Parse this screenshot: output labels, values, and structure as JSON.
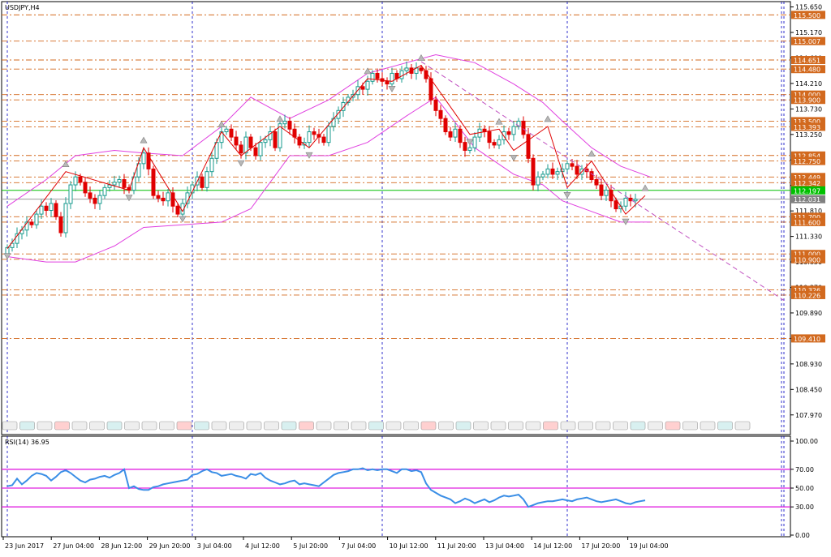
{
  "window": {
    "title": "USDJPY,H4",
    "rsi_label": "RSI(14) 36.95"
  },
  "colors": {
    "bull": "#1a9b8f",
    "bear": "#e00000",
    "bands": "#e040e0",
    "levels": "#d2691e",
    "level_label_bg": "#d2691e",
    "bid_line": "#9a9a9a",
    "green_line": "#00c000",
    "zigzag": "#e00000",
    "trend": "#c050c0",
    "grid": "#0000c0",
    "rsi_line": "#3a8ee6",
    "rsi_levels": "#e020e0"
  },
  "chart_data": [
    {
      "type": "candlestick",
      "title": "USDJPY,H4",
      "ylim": [
        107.6,
        115.75
      ],
      "price_ticks": [
        "115.650",
        "115.170",
        "114.690",
        "114.210",
        "113.730",
        "113.250",
        "112.770",
        "112.290",
        "111.810",
        "111.330",
        "110.850",
        "110.370",
        "109.890",
        "109.410",
        "108.930",
        "108.450",
        "107.970"
      ],
      "date_labels": [
        "23 Jun 2017",
        "27 Jun 04:00",
        "28 Jun 12:00",
        "29 Jun 20:00",
        "3 Jul 04:00",
        "4 Jul 12:00",
        "5 Jul 20:00",
        "7 Jul 04:00",
        "10 Jul 12:00",
        "11 Jul 20:00",
        "13 Jul 04:00",
        "14 Jul 12:00",
        "17 Jul 20:00",
        "19 Jul 04:00"
      ],
      "horizontal_levels": [
        {
          "price": 115.5,
          "label": "115.500"
        },
        {
          "price": 115.007,
          "label": "115.007"
        },
        {
          "price": 114.651,
          "label": "114.651"
        },
        {
          "price": 114.48,
          "label": "114.480"
        },
        {
          "price": 114.0,
          "label": "114.000"
        },
        {
          "price": 113.9,
          "label": "113.900"
        },
        {
          "price": 113.5,
          "label": "113.500"
        },
        {
          "price": 113.393,
          "label": "113.393"
        },
        {
          "price": 112.854,
          "label": "112.854"
        },
        {
          "price": 112.75,
          "label": "112.750"
        },
        {
          "price": 112.449,
          "label": "112.449"
        },
        {
          "price": 112.342,
          "label": "112.342"
        },
        {
          "price": 111.7,
          "label": "111.700"
        },
        {
          "price": 111.6,
          "label": "111.600"
        },
        {
          "price": 111.0,
          "label": "111.000"
        },
        {
          "price": 110.9,
          "label": "110.900"
        },
        {
          "price": 110.326,
          "label": "110.326"
        },
        {
          "price": 110.226,
          "label": "110.226"
        },
        {
          "price": 109.41,
          "label": "109.410"
        }
      ],
      "green_line": {
        "price": 112.197,
        "label": "112.197"
      },
      "bid_line": {
        "price": 112.031,
        "label": "112.031"
      },
      "closes": [
        111.12,
        111.2,
        111.38,
        111.45,
        111.6,
        111.55,
        111.75,
        111.9,
        111.82,
        111.95,
        111.7,
        111.4,
        111.95,
        112.3,
        112.45,
        112.35,
        112.15,
        112.05,
        111.95,
        112.1,
        112.25,
        112.3,
        112.35,
        112.4,
        112.25,
        112.2,
        112.45,
        112.7,
        112.9,
        112.6,
        112.1,
        112.05,
        112.0,
        112.15,
        111.9,
        111.75,
        111.95,
        112.15,
        112.3,
        112.45,
        112.25,
        112.55,
        112.8,
        113.1,
        113.3,
        113.35,
        113.2,
        113.05,
        112.9,
        113.2,
        113.0,
        112.85,
        113.1,
        113.15,
        113.3,
        113.0,
        113.45,
        113.5,
        113.35,
        113.2,
        113.05,
        113.1,
        113.3,
        113.25,
        113.2,
        113.1,
        113.4,
        113.55,
        113.7,
        113.85,
        113.95,
        114.0,
        114.15,
        114.1,
        114.25,
        114.4,
        114.3,
        114.25,
        114.2,
        114.4,
        114.3,
        114.45,
        114.5,
        114.4,
        114.5,
        114.45,
        114.3,
        113.9,
        113.7,
        113.55,
        113.3,
        113.2,
        113.35,
        113.1,
        112.95,
        113.0,
        113.2,
        113.35,
        113.3,
        113.1,
        113.05,
        113.15,
        113.3,
        113.25,
        113.4,
        113.5,
        113.25,
        112.8,
        112.3,
        112.45,
        112.5,
        112.6,
        112.5,
        112.55,
        112.6,
        112.7,
        112.65,
        112.5,
        112.6,
        112.55,
        112.4,
        112.3,
        112.1,
        112.2,
        112.0,
        111.85,
        111.9,
        112.05,
        112.0,
        112.03
      ],
      "zigzag": [
        [
          0,
          111.1
        ],
        [
          12,
          112.55
        ],
        [
          25,
          112.2
        ],
        [
          28,
          113.0
        ],
        [
          36,
          111.8
        ],
        [
          44,
          113.3
        ],
        [
          48,
          112.85
        ],
        [
          56,
          113.4
        ],
        [
          62,
          113.0
        ],
        [
          74,
          114.3
        ],
        [
          79,
          114.25
        ],
        [
          85,
          114.55
        ],
        [
          95,
          113.25
        ],
        [
          101,
          113.35
        ],
        [
          104,
          112.95
        ],
        [
          111,
          113.4
        ],
        [
          115,
          112.25
        ],
        [
          120,
          112.75
        ],
        [
          127,
          111.75
        ],
        [
          131,
          112.1
        ]
      ],
      "trendline": [
        [
          85,
          114.62
        ],
        [
          145,
          111.0
        ]
      ],
      "bollinger_upper": [
        [
          0,
          111.9
        ],
        [
          8,
          112.4
        ],
        [
          14,
          112.85
        ],
        [
          22,
          112.95
        ],
        [
          28,
          112.9
        ],
        [
          36,
          112.85
        ],
        [
          44,
          113.4
        ],
        [
          50,
          113.95
        ],
        [
          58,
          113.55
        ],
        [
          66,
          113.9
        ],
        [
          74,
          114.4
        ],
        [
          82,
          114.6
        ],
        [
          88,
          114.75
        ],
        [
          96,
          114.6
        ],
        [
          104,
          114.2
        ],
        [
          110,
          113.85
        ],
        [
          114,
          113.5
        ],
        [
          120,
          113.0
        ],
        [
          126,
          112.65
        ],
        [
          132,
          112.45
        ]
      ],
      "bollinger_lower": [
        [
          0,
          110.95
        ],
        [
          8,
          110.85
        ],
        [
          14,
          110.85
        ],
        [
          22,
          111.15
        ],
        [
          28,
          111.5
        ],
        [
          36,
          111.55
        ],
        [
          44,
          111.6
        ],
        [
          50,
          111.85
        ],
        [
          58,
          112.85
        ],
        [
          66,
          112.85
        ],
        [
          74,
          113.1
        ],
        [
          82,
          113.6
        ],
        [
          88,
          113.95
        ],
        [
          96,
          113.0
        ],
        [
          104,
          112.5
        ],
        [
          110,
          112.3
        ],
        [
          114,
          112.0
        ],
        [
          120,
          111.8
        ],
        [
          126,
          111.6
        ],
        [
          132,
          111.6
        ]
      ],
      "series": [
        {
          "name": "USDJPY,H4"
        }
      ]
    },
    {
      "type": "line",
      "title": "RSI(14) 36.95",
      "ylim": [
        0,
        100
      ],
      "y_ticks": [
        "100.00",
        "70.00",
        "50.00",
        "30.00",
        "0.00"
      ],
      "levels": [
        70,
        50,
        30
      ],
      "values": [
        52,
        53,
        60,
        54,
        58,
        63,
        66,
        65,
        63,
        58,
        62,
        67,
        69,
        66,
        62,
        58,
        56,
        59,
        60,
        62,
        63,
        61,
        64,
        66,
        70,
        50,
        52,
        49,
        48,
        48,
        51,
        52,
        54,
        55,
        56,
        57,
        58,
        59,
        64,
        65,
        68,
        70,
        67,
        66,
        63,
        64,
        65,
        63,
        62,
        60,
        65,
        64,
        66,
        61,
        58,
        56,
        54,
        55,
        57,
        58,
        54,
        55,
        54,
        53,
        52,
        56,
        60,
        64,
        66,
        67,
        68,
        70,
        70,
        71,
        69,
        70,
        69,
        70,
        70,
        68,
        66,
        70,
        70,
        68,
        69,
        67,
        55,
        48,
        45,
        42,
        40,
        38,
        34,
        36,
        39,
        37,
        34,
        36,
        38,
        35,
        37,
        40,
        42,
        41,
        42,
        43,
        38,
        30,
        32,
        34,
        35,
        36,
        36,
        37,
        38,
        37,
        36,
        38,
        39,
        40,
        38,
        36,
        35,
        36,
        37,
        38,
        36,
        34,
        33,
        35,
        36,
        37
      ],
      "current": 36.95
    }
  ]
}
